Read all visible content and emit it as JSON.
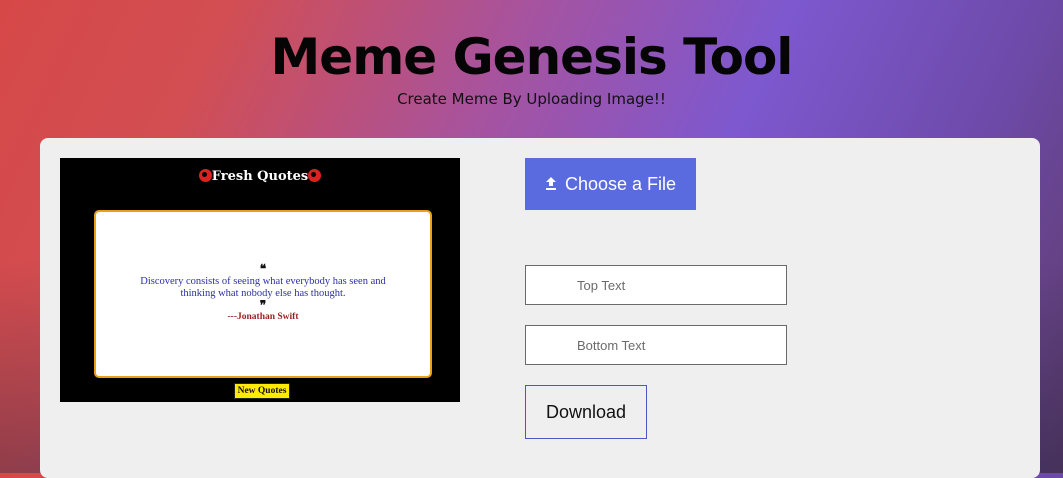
{
  "header": {
    "title": "Meme Genesis Tool",
    "subtitle": "Create Meme By Uploading Image!!"
  },
  "preview": {
    "brand": "Fresh Quotes",
    "open_quote": "❝",
    "quote": "Discovery consists of seeing what everybody has seen and thinking what nobody else has thought.",
    "close_quote": "❞",
    "author": "---Jonathan Swift",
    "new_quotes_label": "New Quotes"
  },
  "controls": {
    "choose_file_label": "Choose a File",
    "top_text_placeholder": "Top Text",
    "bottom_text_placeholder": "Bottom Text",
    "download_label": "Download"
  },
  "colors": {
    "choose_button": "#5a6be0",
    "panel": "#efefef",
    "card_border": "#e8a019",
    "new_quotes_bg": "#ffea00"
  },
  "icons": {
    "upload": "upload-icon",
    "brand_swirl": "swirl-icon"
  }
}
